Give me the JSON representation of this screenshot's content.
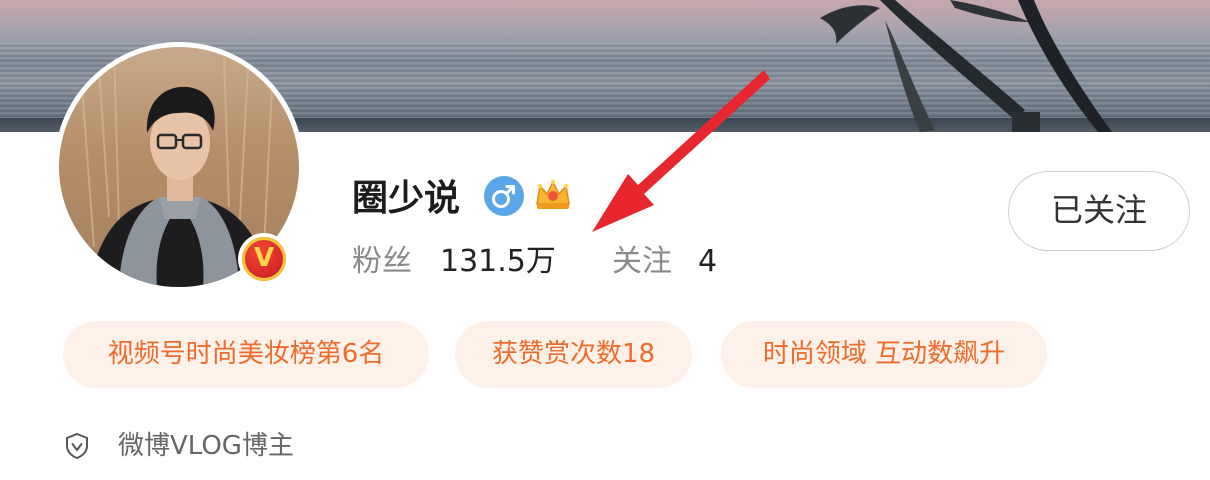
{
  "profile": {
    "name": "圈少说",
    "verified_badge_letter": "V",
    "gender_icon": "male-icon",
    "rank_icon": "crown-icon",
    "stats": {
      "fans_label": "粉丝",
      "fans_value": "131.5万",
      "following_label": "关注",
      "following_value": "4"
    },
    "follow_button_label": "已关注",
    "tags": [
      "视频号时尚美妆榜第6名",
      "获赞赏次数18",
      "时尚领域 互动数飙升"
    ],
    "identity": "微博VLOG博主"
  },
  "colors": {
    "tag_text": "#ef6c2c",
    "tag_background": "#fdf1ea",
    "gender_badge": "#5aa7e8",
    "verified_badge": "#d8262a",
    "annotation_arrow": "#e8262d"
  }
}
